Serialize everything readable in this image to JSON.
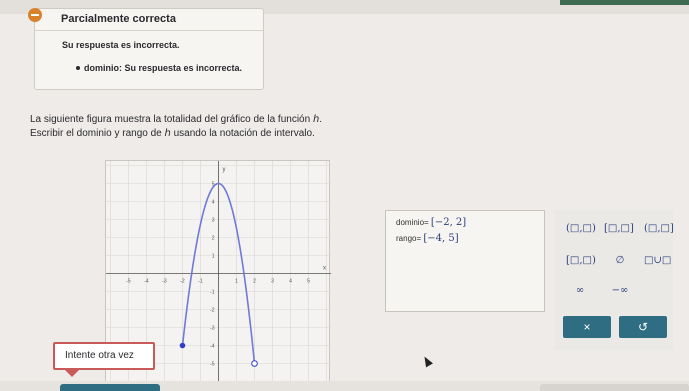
{
  "feedback": {
    "status": "Parcialmente correcta",
    "message": "Su respuesta es incorrecta.",
    "detail": "dominio: Su respuesta es incorrecta."
  },
  "question": {
    "line1": "La siguiente figura muestra la totalidad del gráfico de la función ℎ.",
    "line2": "Escribir el dominio y rango de ℎ usando la notación de intervalo."
  },
  "graph": {
    "x_ticks": [
      "-5",
      "-4",
      "-3",
      "-2",
      "-1",
      "1",
      "2",
      "3",
      "4",
      "5"
    ],
    "y_ticks": [
      "5",
      "4",
      "3",
      "2",
      "1",
      "-1",
      "-2",
      "-3",
      "-4",
      "-5"
    ],
    "x_label": "x",
    "y_label": "y",
    "curve": {
      "vertex": [
        0,
        5
      ],
      "left": [
        -2,
        -4
      ],
      "right": [
        2,
        -5
      ],
      "left_closed": true,
      "right_closed": false
    }
  },
  "answer": {
    "domain_label": "dominio",
    "domain_value": "[−2, 2]",
    "range_label": "rango",
    "range_value": "[−4, 5]"
  },
  "palette": {
    "open_open": "(□,□)",
    "closed_closed": "[□,□]",
    "open_closed": "(□,□]",
    "closed_open": "[□,□)",
    "empty_set": "∅",
    "union": "□∪□",
    "infinity": "∞",
    "neg_infinity": "−∞",
    "clear": "×",
    "undo": "↺"
  },
  "tooltip": "Intente otra vez",
  "colors": {
    "accent": "#2f6d82",
    "curve": "#6f79d8",
    "error": "#c85a5a",
    "warning": "#d9822b"
  }
}
